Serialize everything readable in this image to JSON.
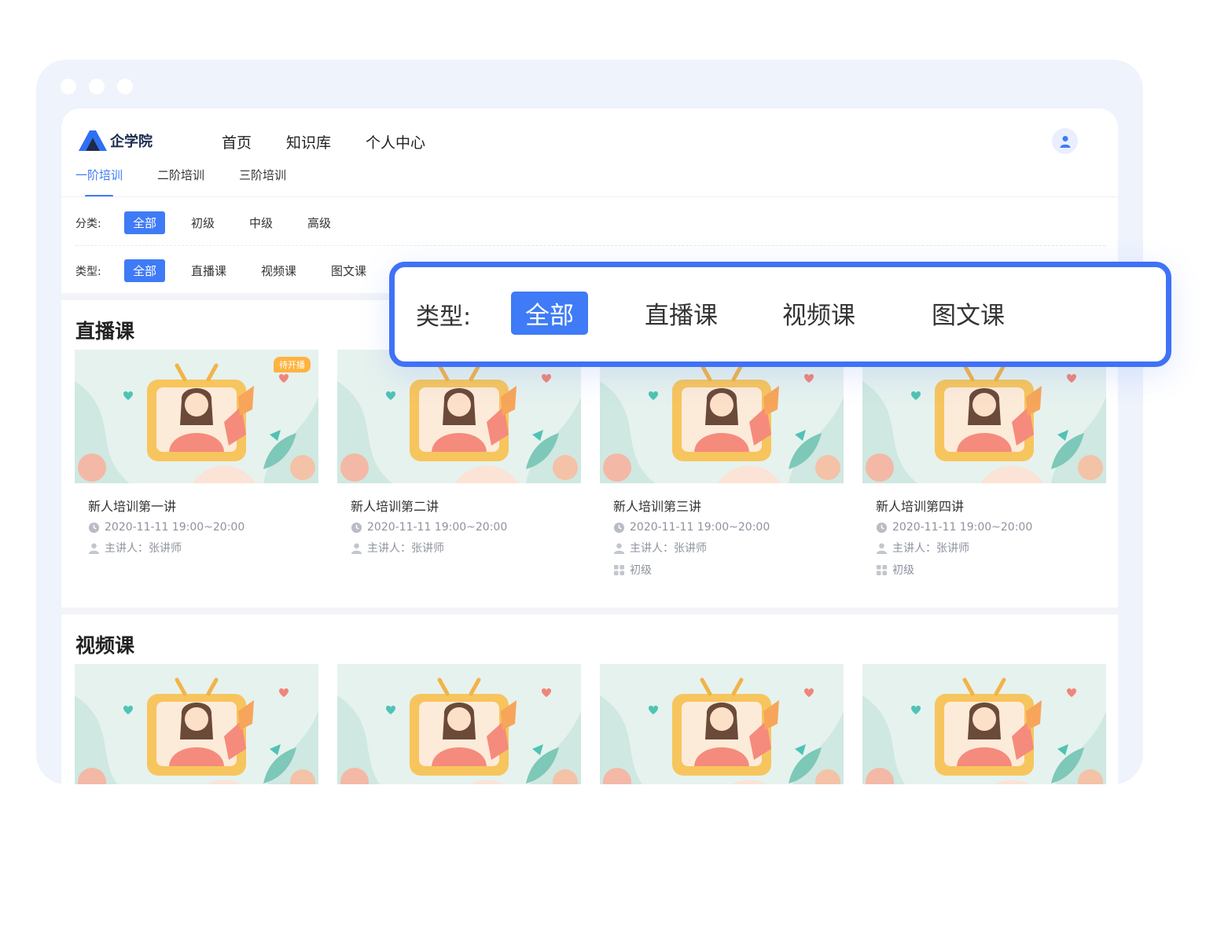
{
  "app": {
    "name": "企学院"
  },
  "nav": {
    "items": [
      "首页",
      "知识库",
      "个人中心"
    ]
  },
  "stage_tabs": [
    {
      "label": "一阶培训",
      "active": true
    },
    {
      "label": "二阶培训",
      "active": false
    },
    {
      "label": "三阶培训",
      "active": false
    }
  ],
  "filters": {
    "category": {
      "label": "分类:",
      "options": [
        "全部",
        "初级",
        "中级",
        "高级"
      ],
      "selected": "全部"
    },
    "type": {
      "label": "类型:",
      "options": [
        "全部",
        "直播课",
        "视频课",
        "图文课"
      ],
      "selected": "全部"
    }
  },
  "callout": {
    "label": "类型:",
    "options": [
      "全部",
      "直播课",
      "视频课",
      "图文课"
    ],
    "selected": "全部"
  },
  "live_section": {
    "title": "直播课",
    "cards": [
      {
        "title": "新人培训第一讲",
        "time": "2020-11-11  19:00~20:00",
        "speaker": "主讲人：张讲师",
        "level": "",
        "badge": "待开播"
      },
      {
        "title": "新人培训第二讲",
        "time": "2020-11-11  19:00~20:00",
        "speaker": "主讲人：张讲师",
        "level": "",
        "badge": ""
      },
      {
        "title": "新人培训第三讲",
        "time": "2020-11-11  19:00~20:00",
        "speaker": "主讲人：张讲师",
        "level": "初级",
        "badge": ""
      },
      {
        "title": "新人培训第四讲",
        "time": "2020-11-11  19:00~20:00",
        "speaker": "主讲人：张讲师",
        "level": "初级",
        "badge": ""
      }
    ]
  },
  "video_section": {
    "title": "视频课"
  },
  "colors": {
    "accent": "#3f7bf6",
    "callout_border": "#3f72f6",
    "badge": "#ffb340"
  }
}
